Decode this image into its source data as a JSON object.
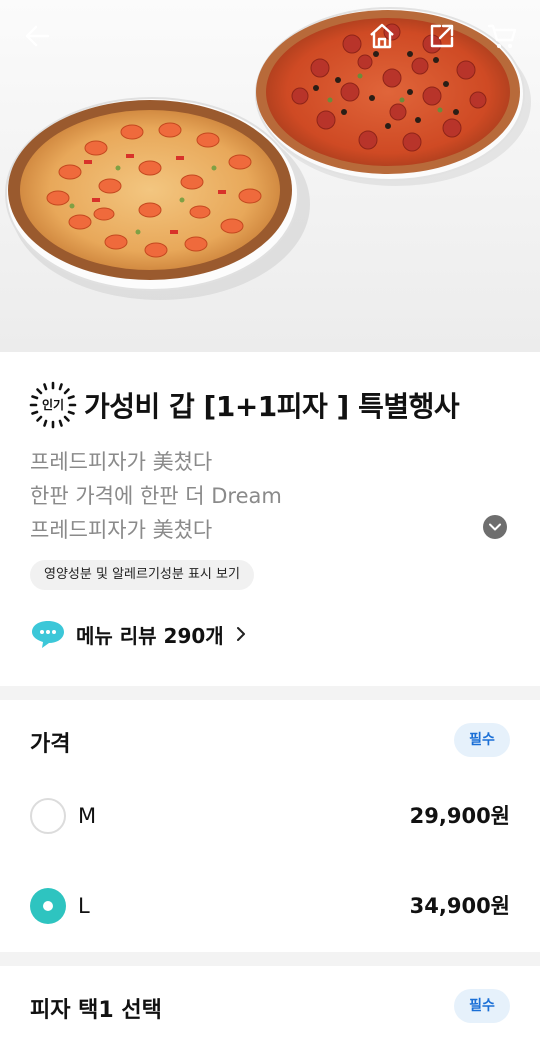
{
  "hero": {
    "image_alt": "Two pizzas: shrimp pizza and pepperoni pizza"
  },
  "topbar": {
    "back_icon": "arrow-left-icon",
    "home_icon": "home-icon",
    "share_icon": "share-icon",
    "cart_icon": "cart-icon"
  },
  "product": {
    "badge": "인기",
    "title": "가성비 갑 [1+1피자 ] 특별행사",
    "description": [
      "프레드피자가 美쳤다",
      "한판 가격에 한판 더 Dream",
      "프레드피자가 美쳤다"
    ],
    "nutrition_label": "영양성분 및 알레르기성분 표시 보기",
    "review_label": "메뉴 리뷰 290개"
  },
  "price_section": {
    "title": "가격",
    "required_label": "필수",
    "options": [
      {
        "label": "M",
        "price": "29,900원",
        "selected": false
      },
      {
        "label": "L",
        "price": "34,900원",
        "selected": true
      }
    ]
  },
  "pizza_section": {
    "title": "피자 택1 선택",
    "required_label": "필수"
  },
  "colors": {
    "accent": "#2ec4c0",
    "required_bg": "#e6f1fb",
    "required_text": "#1a6fd6"
  }
}
